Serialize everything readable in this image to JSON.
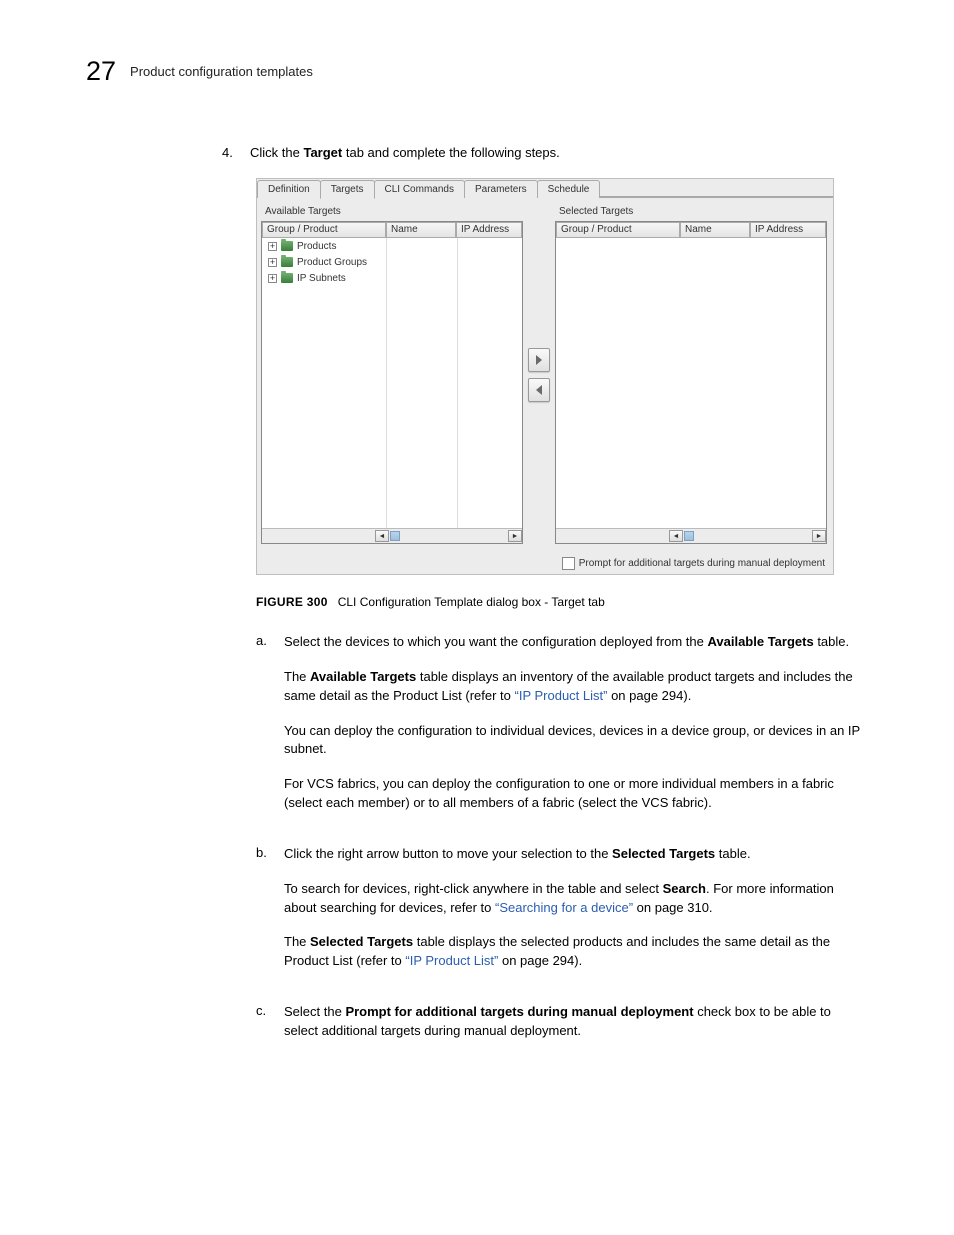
{
  "page_number": "27",
  "header_title": "Product configuration templates",
  "step": {
    "number": "4.",
    "text_before": "Click the ",
    "bold": "Target",
    "text_after": " tab and complete the following steps."
  },
  "dialog": {
    "tabs": [
      "Definition",
      "Targets",
      "CLI Commands",
      "Parameters",
      "Schedule"
    ],
    "active_tab_index": 1,
    "left_panel_title": "Available Targets",
    "right_panel_title": "Selected Targets",
    "columns": [
      "Group / Product",
      "Name",
      "IP Address"
    ],
    "tree_items": [
      "Products",
      "Product Groups",
      "IP Subnets"
    ],
    "footer_checkbox_label": "Prompt for additional targets during manual deployment"
  },
  "figure": {
    "label": "FIGURE 300",
    "caption": "CLI Configuration Template dialog box - Target tab"
  },
  "substeps": {
    "a": {
      "letter": "a.",
      "p1_prefix": "Select the devices to which you want the configuration deployed from the ",
      "p1_bold": "Available Targets",
      "p1_suffix": " table.",
      "p2_prefix": "The ",
      "p2_bold": "Available Targets",
      "p2_mid": " table displays an inventory of the available product targets and includes the same detail as the Product List (refer to ",
      "p2_link": "“IP Product List”",
      "p2_suffix": " on page 294).",
      "p3": "You can deploy the configuration to individual devices, devices in a device group, or devices in an IP subnet.",
      "p4": "For VCS fabrics, you can deploy the configuration to one or more individual members in a fabric (select each member) or to all members of a fabric (select the VCS fabric)."
    },
    "b": {
      "letter": "b.",
      "p1_prefix": "Click the right arrow button to move your selection to the ",
      "p1_bold": "Selected Targets",
      "p1_suffix": " table.",
      "p2_prefix": "To search for devices, right-click anywhere in the table and select ",
      "p2_bold": "Search",
      "p2_mid": ". For more information about searching for devices, refer to ",
      "p2_link": "“Searching for a device”",
      "p2_suffix": " on page 310.",
      "p3_prefix": "The ",
      "p3_bold": "Selected Targets",
      "p3_mid": " table displays the selected products and includes the same detail as the Product List (refer to ",
      "p3_link": "“IP Product List”",
      "p3_suffix": " on page 294)."
    },
    "c": {
      "letter": "c.",
      "p1_prefix": "Select the ",
      "p1_bold": "Prompt for additional targets during manual deployment",
      "p1_suffix": " check box to be able to select additional targets during manual deployment."
    }
  }
}
